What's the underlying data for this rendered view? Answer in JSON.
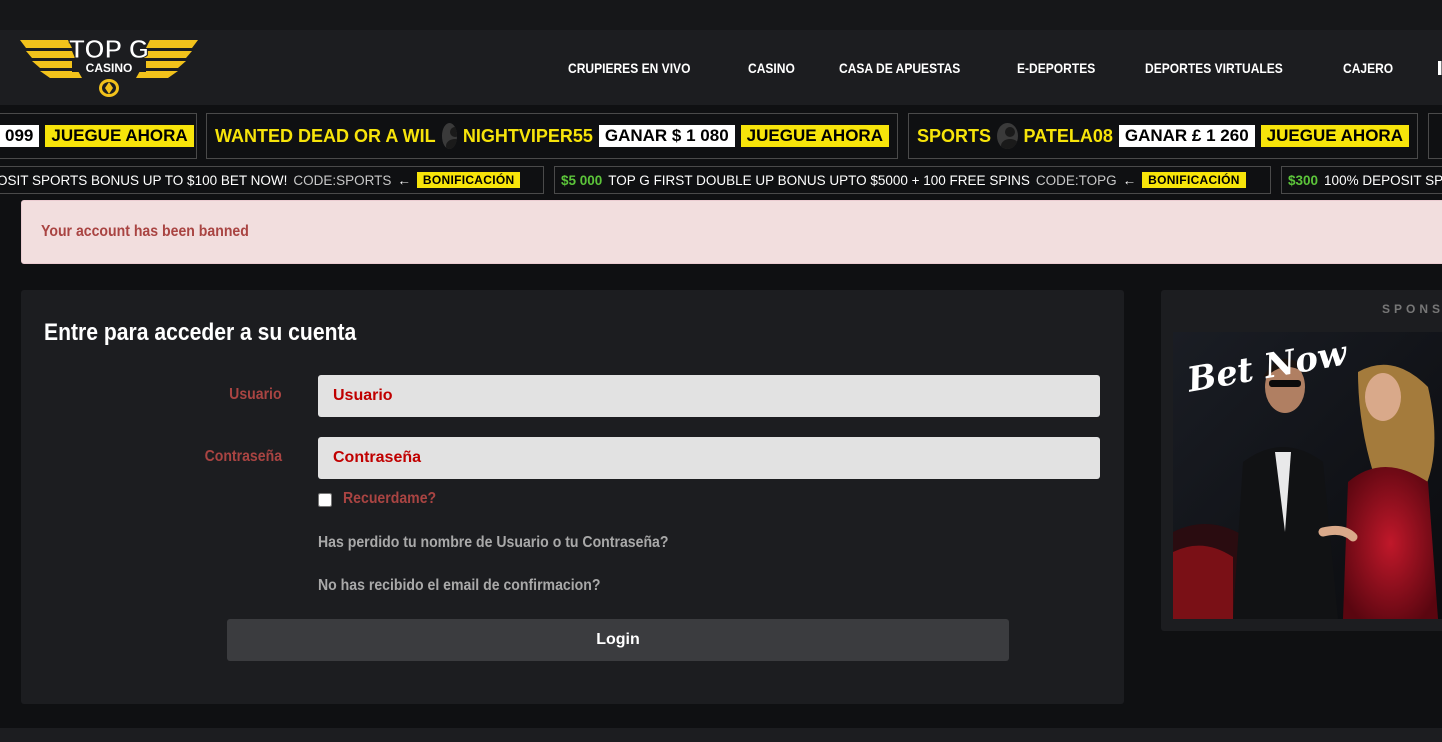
{
  "brand": {
    "logo_top": "TOP G",
    "logo_bottom": "CASINO",
    "accent": "#f7e40a"
  },
  "nav": {
    "items": [
      "CRUPIERES EN VIVO",
      "CASINO",
      "CASA DE APUESTAS",
      "E-DEPORTES",
      "DEPORTES VIRTUALES",
      "CAJERO"
    ]
  },
  "ticker": {
    "items": [
      {
        "game": "",
        "user": "",
        "win": "099",
        "play": "JUEGUE AHORA"
      },
      {
        "game": "WANTED DEAD OR A WIL",
        "user": "NIGHTVIPER55",
        "win": "GANAR $ 1 080",
        "play": "JUEGUE AHORA"
      },
      {
        "game": "SPORTS",
        "user": "PATELA08",
        "win": "GANAR £ 1 260",
        "play": "JUEGUE AHORA"
      }
    ]
  },
  "bonuses": {
    "items": [
      {
        "amount": "",
        "text": "OSIT SPORTS BONUS UP TO $100 BET NOW!",
        "code": "CODE:SPORTS",
        "button": "BONIFICACIÓN"
      },
      {
        "amount": "$5 000",
        "text": "TOP G FIRST DOUBLE UP BONUS UPTO $5000 + 100 FREE SPINS",
        "code": "CODE:TOPG",
        "button": "BONIFICACIÓN"
      },
      {
        "amount": "$300",
        "text": "100% DEPOSIT SP",
        "code": "",
        "button": ""
      }
    ]
  },
  "alert": {
    "message": "Your account has been banned"
  },
  "login": {
    "title": "Entre para acceder a su cuenta",
    "username_label": "Usuario",
    "username_placeholder": "Usuario",
    "password_label": "Contraseña",
    "password_placeholder": "Contraseña",
    "remember_label": "Recuerdame?",
    "remember_checked": false,
    "forgot_link": "Has perdido tu nombre de Usuario o tu Contraseña?",
    "confirm_link": "No has recibido el email de confirmacion?",
    "submit_label": "Login"
  },
  "sponsor": {
    "label": "SPONSO",
    "image_text": "Bet Now"
  }
}
